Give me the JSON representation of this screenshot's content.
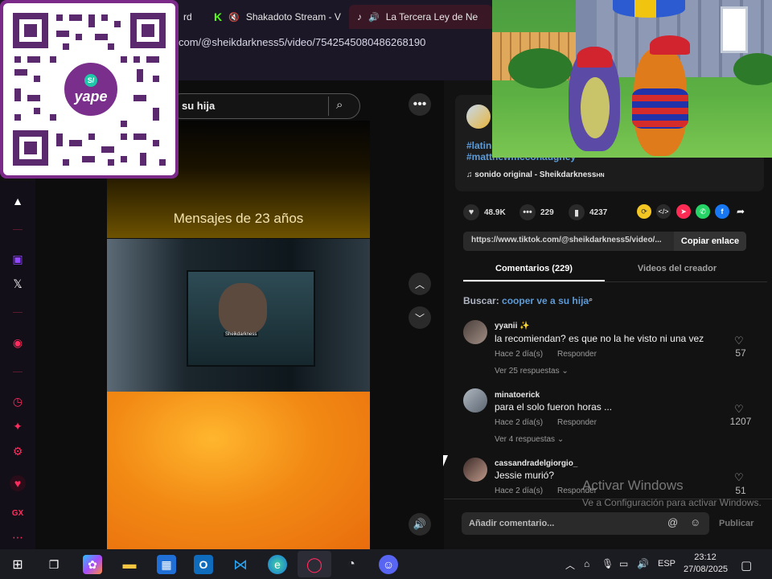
{
  "browser": {
    "tabs": [
      {
        "label": "rd",
        "icon": "none"
      },
      {
        "label": "Shakadoto Stream - V",
        "icon": "kick-icon"
      },
      {
        "label": "La Tercera Ley de Ne",
        "icon": "tiktok-icon"
      }
    ],
    "url": "com/@sheikdarkness5/video/7542545080486268190"
  },
  "video": {
    "search_query": "su hija",
    "caption": "Mensajes de 23 años",
    "screen_label": "Sheikdarkness"
  },
  "post": {
    "hashtags_line1": "#latin",
    "hashtags_line2": "#matthewmcconaughey",
    "sound": "sonido original - Sheikdarkness",
    "sound_suffix": "HN",
    "likes": "48.9K",
    "comments": "229",
    "saves": "4237",
    "link": "https://www.tiktok.com/@sheikdarkness5/video/...",
    "copy_label": "Copiar enlace"
  },
  "tabs": {
    "comments": "Comentarios (229)",
    "creator_videos": "Videos del creador"
  },
  "search_result": {
    "prefix": "Buscar:",
    "query": "cooper ve a su hija"
  },
  "comments": [
    {
      "user": "yyanii ✨",
      "text": "la recomiendan? es que no la he visto ni una vez",
      "time": "Hace 2 día(s)",
      "reply": "Responder",
      "more": "Ver 25 respuestas",
      "likes": "57"
    },
    {
      "user": "minatoerick",
      "text": "para el solo fueron horas ...",
      "time": "Hace 2 día(s)",
      "reply": "Responder",
      "more": "Ver 4 respuestas",
      "likes": "1207"
    },
    {
      "user": "cassandradelgiorgio_",
      "text": "Jessie murió?",
      "time": "Hace 2 día(s)",
      "reply": "Responder",
      "likes": "51"
    }
  ],
  "composer": {
    "placeholder": "Añadir comentario...",
    "publish": "Publicar"
  },
  "qr": {
    "brand": "yape",
    "currency": "S/"
  },
  "watermark": {
    "title": "Activar Windows",
    "subtitle": "Ve a Configuración para activar Windows."
  },
  "sidebar": {
    "gx_label": "GX"
  },
  "taskbar": {
    "language": "ESP",
    "time": "23:12",
    "date": "27/08/2025"
  },
  "colors": {
    "accent_gx": "#ff2b5e",
    "link_blue": "#5d9bd8",
    "panel_bg": "#121212"
  }
}
